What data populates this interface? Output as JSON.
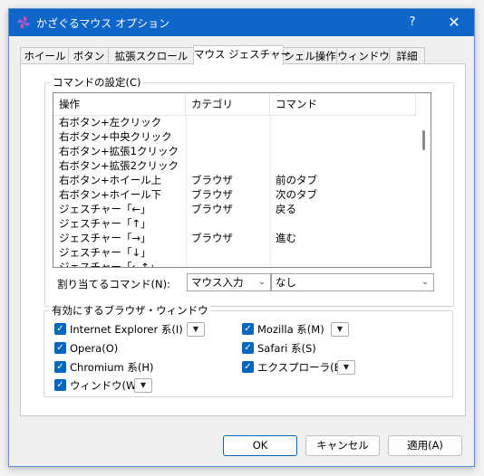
{
  "window": {
    "title": "かざぐるマウス オプション",
    "help": "?",
    "close": "✕"
  },
  "tabs": [
    {
      "label": "ホイール"
    },
    {
      "label": "ボタン"
    },
    {
      "label": "拡張スクロール"
    },
    {
      "label": "マウス ジェスチャー"
    },
    {
      "label": "シェル操作"
    },
    {
      "label": "ウィンドウ"
    },
    {
      "label": "詳細"
    }
  ],
  "commands_group": {
    "title": "コマンドの設定(C)"
  },
  "list": {
    "columns": [
      "操作",
      "カテゴリ",
      "コマンド"
    ],
    "rows": [
      {
        "op": "右ボタン+左クリック",
        "cat": "",
        "cmd": ""
      },
      {
        "op": "右ボタン+中央クリック",
        "cat": "",
        "cmd": ""
      },
      {
        "op": "右ボタン+拡張1クリック",
        "cat": "",
        "cmd": ""
      },
      {
        "op": "右ボタン+拡張2クリック",
        "cat": "",
        "cmd": ""
      },
      {
        "op": "右ボタン+ホイール上",
        "cat": "ブラウザ",
        "cmd": "前のタブ"
      },
      {
        "op": "右ボタン+ホイール下",
        "cat": "ブラウザ",
        "cmd": "次のタブ"
      },
      {
        "op": "ジェスチャー「←」",
        "cat": "ブラウザ",
        "cmd": "戻る"
      },
      {
        "op": "ジェスチャー「↑」",
        "cat": "",
        "cmd": ""
      },
      {
        "op": "ジェスチャー「→」",
        "cat": "ブラウザ",
        "cmd": "進む"
      },
      {
        "op": "ジェスチャー「↓」",
        "cat": "",
        "cmd": ""
      },
      {
        "op": "ジェスチャー「←↑」",
        "cat": "",
        "cmd": ""
      }
    ]
  },
  "assign": {
    "label": "割り当てるコマンド(N):",
    "category_value": "マウス入力",
    "command_value": "なし"
  },
  "browser_group": {
    "title": "有効にするブラウザ・ウィンドウ"
  },
  "browsers": {
    "ie": "Internet Explorer 系(I)",
    "mozilla": "Mozilla 系(M)",
    "opera": "Opera(O)",
    "safari": "Safari 系(S)",
    "chromium": "Chromium 系(H)",
    "explorer": "エクスプローラ(E)",
    "window": "ウィンドウ(W)"
  },
  "buttons": {
    "ok": "OK",
    "cancel": "キャンセル",
    "apply": "適用(A)"
  },
  "colors": {
    "titlebar": "#0e66c8",
    "checkbox": "#0067c0"
  }
}
